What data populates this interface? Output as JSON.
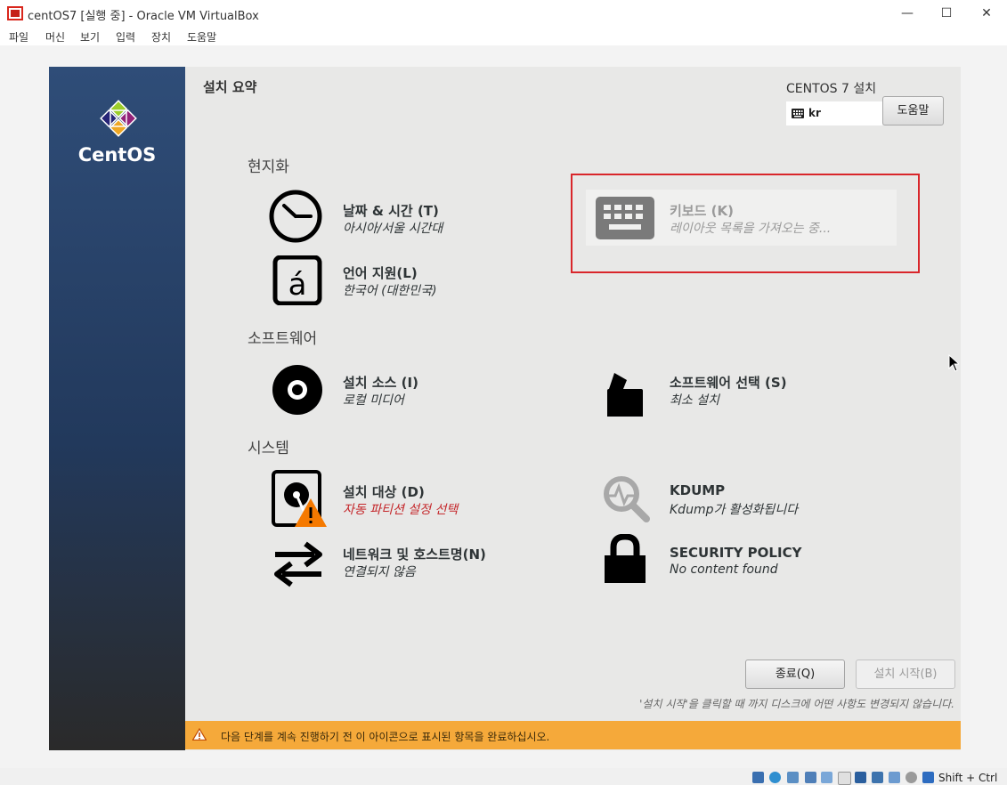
{
  "window": {
    "title": "centOS7 [실행 중] - Oracle VM VirtualBox",
    "minimize": "—",
    "maximize": "☐",
    "close": "✕"
  },
  "menu": [
    "파일",
    "머신",
    "보기",
    "입력",
    "장치",
    "도움말"
  ],
  "installer": {
    "sidebar_logo": "CentOS",
    "header_title": "설치 요약",
    "header_product": "CENTOS 7 설치",
    "keyboard_layout": "kr",
    "help_button": "도움말",
    "sections": {
      "localization": "현지화",
      "software": "소프트웨어",
      "system": "시스템"
    },
    "spokes": {
      "datetime": {
        "title": "날짜 & 시간 (T)",
        "status": "아시아/서울 시간대",
        "icon": "clock-icon"
      },
      "keyboard": {
        "title": "키보드 (K)",
        "status": "레이아웃 목록을 가져오는 중...",
        "icon": "keyboard-icon"
      },
      "language": {
        "title": "언어 지원(L)",
        "status": "한국어 (대한민국)",
        "icon": "language-icon"
      },
      "source": {
        "title": "설치 소스 (I)",
        "status": "로컬 미디어",
        "icon": "disc-icon"
      },
      "software_selection": {
        "title": "소프트웨어 선택 (S)",
        "status": "최소 설치",
        "icon": "package-icon"
      },
      "destination": {
        "title": "설치 대상 (D)",
        "status": "자동 파티션 설정 선택",
        "icon": "harddisk-warning-icon"
      },
      "kdump": {
        "title": "KDUMP",
        "status": "Kdump가 활성화됩니다",
        "icon": "kdump-search-icon"
      },
      "network": {
        "title": "네트워크 및 호스트명(N)",
        "status": "연결되지 않음",
        "icon": "network-arrows-icon"
      },
      "security": {
        "title": "SECURITY POLICY",
        "status": "No content found",
        "icon": "lock-icon"
      }
    },
    "quit_button": "종료(Q)",
    "begin_button": "설치 시작(B)",
    "note": "'설치 시작'을 클릭할 때 까지 디스크에 어떤 사항도 변경되지 않습니다.",
    "warning_bar": "다음 단계를 계속 진행하기 전 이 아이콘으로 표시된 항목을 완료하십시오."
  },
  "statusbar": {
    "host_key": "Shift + Ctrl"
  },
  "colors": {
    "sidebar": "#2f4d78",
    "warning_bar": "#f5a93a",
    "warning_text": "#c4262a",
    "highlight_frame": "#d9262b"
  }
}
